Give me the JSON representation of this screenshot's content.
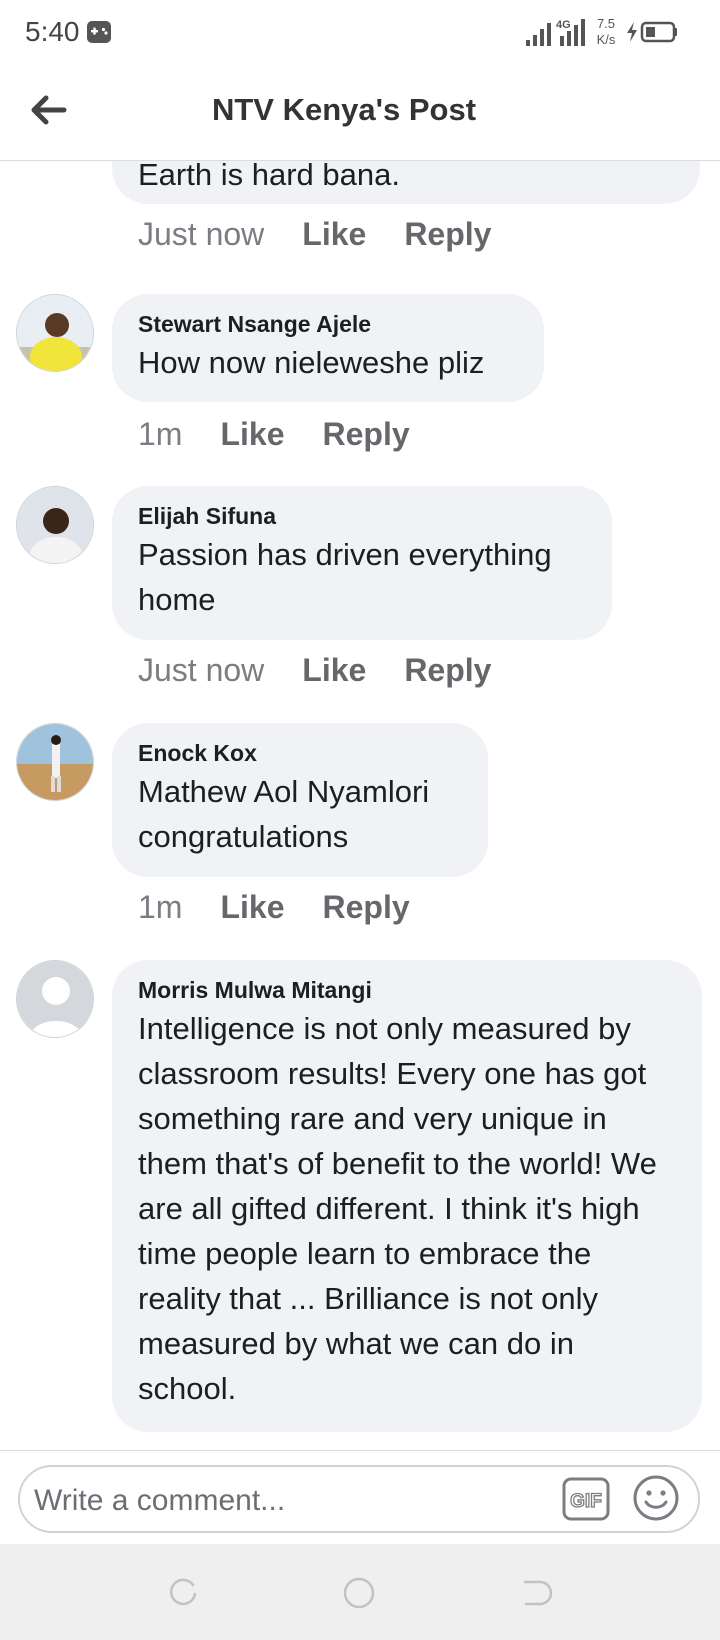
{
  "status_bar": {
    "time": "5:40",
    "network_type": "4G",
    "speed_value": "7.5",
    "speed_unit": "K/s",
    "icons": [
      "game-controller-icon",
      "signal-icon",
      "charging-icon",
      "battery-icon"
    ]
  },
  "header": {
    "title": "NTV Kenya's Post",
    "back_icon": "arrow-left-icon"
  },
  "comments": [
    {
      "author": "",
      "text": "Earth is hard bana.",
      "time": "Just now",
      "like_label": "Like",
      "reply_label": "Reply"
    },
    {
      "author": "Stewart Nsange Ajele",
      "text": "How now nieleweshe pliz",
      "time": "1m",
      "like_label": "Like",
      "reply_label": "Reply"
    },
    {
      "author": "Elijah Sifuna",
      "text": "Passion has driven everything home",
      "time": "Just now",
      "like_label": "Like",
      "reply_label": "Reply"
    },
    {
      "author": "Enock Kox",
      "text": "Mathew Aol Nyamlori congratulations",
      "time": "1m",
      "like_label": "Like",
      "reply_label": "Reply"
    },
    {
      "author": "Morris Mulwa Mitangi",
      "text": "Intelligence is not only measured by classroom results! Every one has got something rare and very unique in them that's of benefit to the world! We are all gifted different. I think it's high time people learn to embrace the reality that ... Brilliance is not only measured by what we can do in school."
    }
  ],
  "composer": {
    "placeholder": "Write a comment...",
    "gif_label": "GIF",
    "emoji_icon": "smiley-icon"
  },
  "nav_bar": {
    "icons": [
      "recents-icon",
      "home-icon",
      "back-icon"
    ]
  },
  "colors": {
    "bubble": "#f0f2f5",
    "meta_text": "#65676b",
    "title": "#333333"
  }
}
